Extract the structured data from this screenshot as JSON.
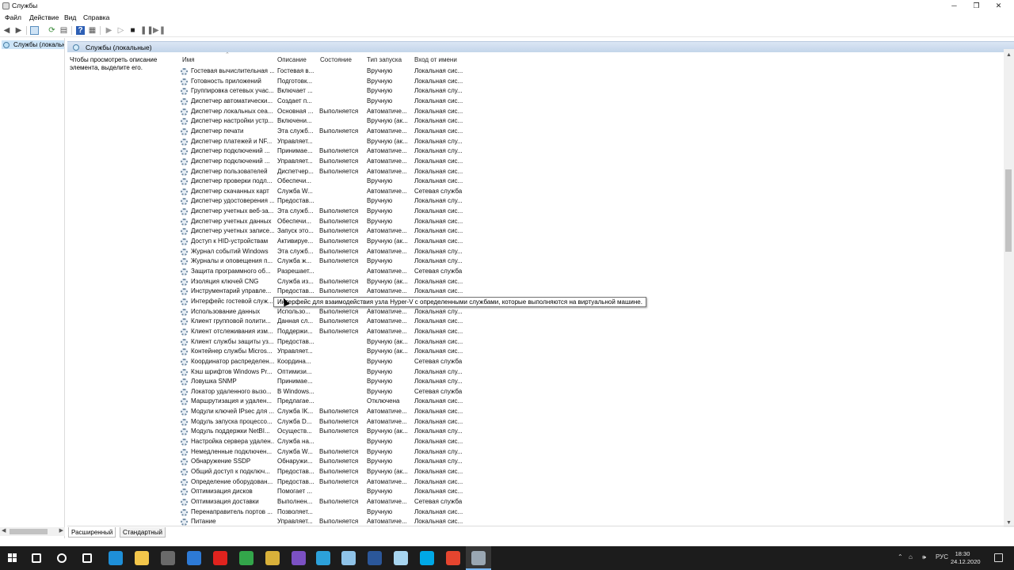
{
  "window": {
    "title": "Службы",
    "controls": {
      "minimize": "─",
      "maximize": "❐",
      "close": "✕"
    }
  },
  "menu": [
    "Файл",
    "Действие",
    "Вид",
    "Справка"
  ],
  "tree": {
    "item_label": "Службы (локальны"
  },
  "pane": {
    "header": "Службы (локальные)",
    "description_hint": "Чтобы просмотреть описание элемента, выделите его."
  },
  "columns": {
    "name": "Имя",
    "description": "Описание",
    "state": "Состояние",
    "startup": "Тип запуска",
    "logon": "Вход от имени"
  },
  "services": [
    {
      "name": "Гостевая вычислительная ...",
      "description": "Гостевая в...",
      "state": "",
      "startup": "Вручную",
      "logon": "Локальная сис..."
    },
    {
      "name": "Готовность приложений",
      "description": "Подготовк...",
      "state": "",
      "startup": "Вручную",
      "logon": "Локальная сис..."
    },
    {
      "name": "Группировка сетевых учас...",
      "description": "Включает ...",
      "state": "",
      "startup": "Вручную",
      "logon": "Локальная слу..."
    },
    {
      "name": "Диспетчер автоматически...",
      "description": "Создает п...",
      "state": "",
      "startup": "Вручную",
      "logon": "Локальная сис..."
    },
    {
      "name": "Диспетчер локальных сеа...",
      "description": "Основная ...",
      "state": "Выполняется",
      "startup": "Автоматиче...",
      "logon": "Локальная сис..."
    },
    {
      "name": "Диспетчер настройки устр...",
      "description": "Включени...",
      "state": "",
      "startup": "Вручную (ак...",
      "logon": "Локальная сис..."
    },
    {
      "name": "Диспетчер печати",
      "description": "Эта служб...",
      "state": "Выполняется",
      "startup": "Автоматиче...",
      "logon": "Локальная сис..."
    },
    {
      "name": "Диспетчер платежей и NF...",
      "description": "Управляет...",
      "state": "",
      "startup": "Вручную (ак...",
      "logon": "Локальная слу..."
    },
    {
      "name": "Диспетчер подключений ...",
      "description": "Принимае...",
      "state": "Выполняется",
      "startup": "Автоматиче...",
      "logon": "Локальная слу..."
    },
    {
      "name": "Диспетчер подключений ...",
      "description": "Управляет...",
      "state": "Выполняется",
      "startup": "Автоматиче...",
      "logon": "Локальная сис..."
    },
    {
      "name": "Диспетчер пользователей",
      "description": "Диспетчер...",
      "state": "Выполняется",
      "startup": "Автоматиче...",
      "logon": "Локальная сис..."
    },
    {
      "name": "Диспетчер проверки подл...",
      "description": "Обеспечи...",
      "state": "",
      "startup": "Вручную",
      "logon": "Локальная сис..."
    },
    {
      "name": "Диспетчер скачанных карт",
      "description": "Служба W...",
      "state": "",
      "startup": "Автоматиче...",
      "logon": "Сетевая служба"
    },
    {
      "name": "Диспетчер удостоверения ...",
      "description": "Предостав...",
      "state": "",
      "startup": "Вручную",
      "logon": "Локальная слу..."
    },
    {
      "name": "Диспетчер учетных веб-за...",
      "description": "Эта служб...",
      "state": "Выполняется",
      "startup": "Вручную",
      "logon": "Локальная сис..."
    },
    {
      "name": "Диспетчер учетных данных",
      "description": "Обеспечи...",
      "state": "Выполняется",
      "startup": "Вручную",
      "logon": "Локальная сис..."
    },
    {
      "name": "Диспетчер учетных записе...",
      "description": "Запуск это...",
      "state": "Выполняется",
      "startup": "Автоматиче...",
      "logon": "Локальная сис..."
    },
    {
      "name": "Доступ к HID-устройствам",
      "description": "Активируе...",
      "state": "Выполняется",
      "startup": "Вручную (ак...",
      "logon": "Локальная сис..."
    },
    {
      "name": "Журнал событий Windows",
      "description": "Эта служб...",
      "state": "Выполняется",
      "startup": "Автоматиче...",
      "logon": "Локальная слу..."
    },
    {
      "name": "Журналы и оповещения п...",
      "description": "Служба ж...",
      "state": "Выполняется",
      "startup": "Вручную",
      "logon": "Локальная слу..."
    },
    {
      "name": "Защита программного об...",
      "description": "Разрешает...",
      "state": "",
      "startup": "Автоматиче...",
      "logon": "Сетевая служба"
    },
    {
      "name": "Изоляция ключей CNG",
      "description": "Служба из...",
      "state": "Выполняется",
      "startup": "Вручную (ак...",
      "logon": "Локальная сис..."
    },
    {
      "name": "Инструментарий управле...",
      "description": "Предостав...",
      "state": "Выполняется",
      "startup": "Автоматиче...",
      "logon": "Локальная сис..."
    },
    {
      "name": "Интерфейс гостевой служ...",
      "description": "",
      "state": "",
      "startup": "",
      "logon": ""
    },
    {
      "name": "Использование данных",
      "description": "Использо...",
      "state": "Выполняется",
      "startup": "Автоматиче...",
      "logon": "Локальная слу..."
    },
    {
      "name": "Клиент групповой полити...",
      "description": "Данная сл...",
      "state": "Выполняется",
      "startup": "Автоматиче...",
      "logon": "Локальная сис..."
    },
    {
      "name": "Клиент отслеживания изм...",
      "description": "Поддержи...",
      "state": "Выполняется",
      "startup": "Автоматиче...",
      "logon": "Локальная сис..."
    },
    {
      "name": "Клиент службы защиты уз...",
      "description": "Предостав...",
      "state": "",
      "startup": "Вручную (ак...",
      "logon": "Локальная сис..."
    },
    {
      "name": "Контейнер службы Micros...",
      "description": "Управляет...",
      "state": "",
      "startup": "Вручную (ак...",
      "logon": "Локальная сис..."
    },
    {
      "name": "Координатор распределен...",
      "description": "Координа...",
      "state": "",
      "startup": "Вручную",
      "logon": "Сетевая служба"
    },
    {
      "name": "Кэш шрифтов Windows Pr...",
      "description": "Оптимизи...",
      "state": "",
      "startup": "Вручную",
      "logon": "Локальная слу..."
    },
    {
      "name": "Ловушка SNMP",
      "description": "Принимае...",
      "state": "",
      "startup": "Вручную",
      "logon": "Локальная слу..."
    },
    {
      "name": "Локатор удаленного вызо...",
      "description": "В Windows...",
      "state": "",
      "startup": "Вручную",
      "logon": "Сетевая служба"
    },
    {
      "name": "Маршрутизация и удален...",
      "description": "Предлагае...",
      "state": "",
      "startup": "Отключена",
      "logon": "Локальная сис..."
    },
    {
      "name": "Модули ключей IPsec для ...",
      "description": "Служба IK...",
      "state": "Выполняется",
      "startup": "Автоматиче...",
      "logon": "Локальная сис..."
    },
    {
      "name": "Модуль запуска процессо...",
      "description": "Служба D...",
      "state": "Выполняется",
      "startup": "Автоматиче...",
      "logon": "Локальная сис..."
    },
    {
      "name": "Модуль поддержки NetBI...",
      "description": "Осуществ...",
      "state": "Выполняется",
      "startup": "Вручную (ак...",
      "logon": "Локальная слу..."
    },
    {
      "name": "Настройка сервера удален...",
      "description": "Служба на...",
      "state": "",
      "startup": "Вручную",
      "logon": "Локальная сис..."
    },
    {
      "name": "Немедленные подключен...",
      "description": "Служба W...",
      "state": "Выполняется",
      "startup": "Вручную",
      "logon": "Локальная слу..."
    },
    {
      "name": "Обнаружение SSDP",
      "description": "Обнаружи...",
      "state": "Выполняется",
      "startup": "Вручную",
      "logon": "Локальная слу..."
    },
    {
      "name": "Общий доступ к подключ...",
      "description": "Предостав...",
      "state": "Выполняется",
      "startup": "Вручную (ак...",
      "logon": "Локальная сис..."
    },
    {
      "name": "Определение оборудован...",
      "description": "Предостав...",
      "state": "Выполняется",
      "startup": "Автоматиче...",
      "logon": "Локальная сис..."
    },
    {
      "name": "Оптимизация дисков",
      "description": "Помогает ...",
      "state": "",
      "startup": "Вручную",
      "logon": "Локальная сис..."
    },
    {
      "name": "Оптимизация доставки",
      "description": "Выполнен...",
      "state": "Выполняется",
      "startup": "Автоматиче...",
      "logon": "Сетевая служба"
    },
    {
      "name": "Перенаправитель портов ...",
      "description": "Позволяет...",
      "state": "",
      "startup": "Вручную",
      "logon": "Локальная сис..."
    },
    {
      "name": "Питание",
      "description": "Управляет...",
      "state": "Выполняется",
      "startup": "Автоматиче...",
      "logon": "Локальная сис..."
    }
  ],
  "tooltip": "Интерфейс для взаимодействия узла Hyper-V с определенными службами, которые выполняются на виртуальной машине.",
  "tabs": [
    "Расширенный",
    "Стандартный"
  ],
  "taskbar": {
    "language": "РУС",
    "time": "18:30",
    "date": "24.12.2020",
    "apps": [
      "search-icon",
      "cortana-icon",
      "task-view-icon",
      "edge-icon",
      "explorer-icon",
      "store-icon",
      "mail-icon",
      "opera-icon",
      "camtasia-icon",
      "chrome-icon",
      "viber-icon",
      "telegram-icon",
      "notepad-icon",
      "word-icon",
      "notepad2-icon",
      "skype-icon",
      "recorder-icon",
      "services-icon"
    ],
    "app_colors": [
      "#ffffff",
      "#ffffff",
      "#ffffff",
      "#1e8fd8",
      "#f3c64b",
      "#6a6a6a",
      "#2d7ad6",
      "#e0231e",
      "#33a64a",
      "#d9b13a",
      "#7b51c3",
      "#2ca1da",
      "#8fc3e8",
      "#2b579a",
      "#a7d5f0",
      "#00a8e6",
      "#e5452f",
      "#9aa7b3"
    ]
  }
}
